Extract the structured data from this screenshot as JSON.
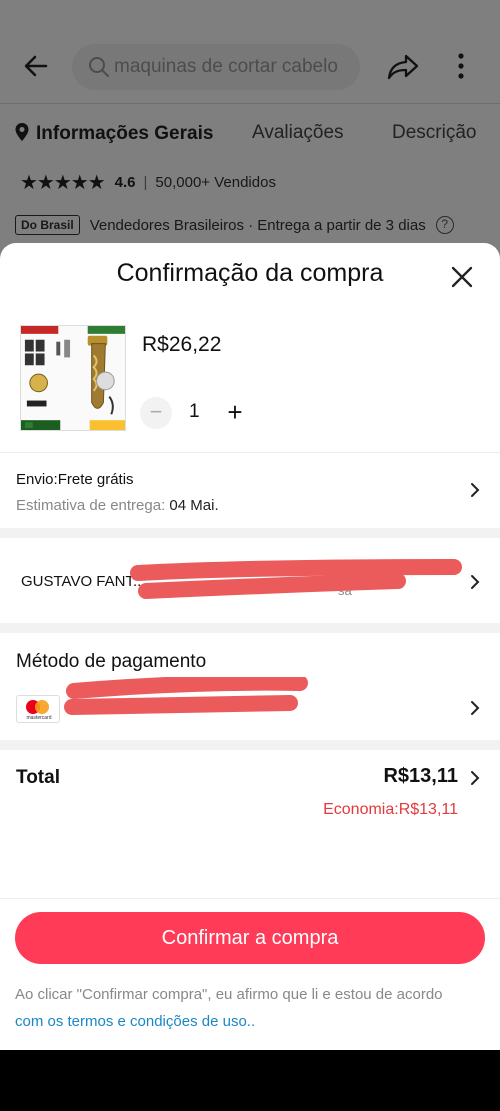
{
  "header": {
    "search_placeholder": "maquinas de cortar cabelo",
    "icons": [
      "back-arrow-icon",
      "search-icon",
      "share-icon",
      "more-vertical-icon"
    ]
  },
  "tabs": [
    {
      "label": "Informações Gerais",
      "active": true
    },
    {
      "label": "Avaliações",
      "active": false
    },
    {
      "label": "Descrição",
      "active": false
    }
  ],
  "rating": {
    "stars": "★★★★★",
    "value": "4.6",
    "separator": "|",
    "sold": "50,000+ Vendidos"
  },
  "seller": {
    "badge": "Do Brasil",
    "text": "Vendedores Brasileiros · Entrega a partir de 3 dias",
    "help": "?"
  },
  "sheet": {
    "title": "Confirmação da compra",
    "product": {
      "price": "R$26,22",
      "quantity": "1",
      "minus": "−",
      "plus": "+"
    },
    "shipping": {
      "line1": "Envio:Frete grátis",
      "estimate_label": "Estimativa de entrega: ",
      "estimate_date": "04 Mai."
    },
    "address": {
      "name": "GUSTAVO FANT...",
      "tail": "sa"
    },
    "payment": {
      "title": "Método de pagamento",
      "card_brand": "mastercard"
    },
    "total": {
      "label": "Total",
      "value": "R$13,11",
      "economy": "Economia:R$13,11"
    },
    "confirm_button": "Confirmar a compra",
    "legal_text": "Ao clicar \"Confirmar compra\", eu afirmo que li e estou de acordo ",
    "legal_link": "com os termos e condições de uso.."
  },
  "colors": {
    "accent": "#ff3b57",
    "economy": "#e4393c",
    "link": "#1a87c5",
    "redaction": "#ec5b5b"
  }
}
